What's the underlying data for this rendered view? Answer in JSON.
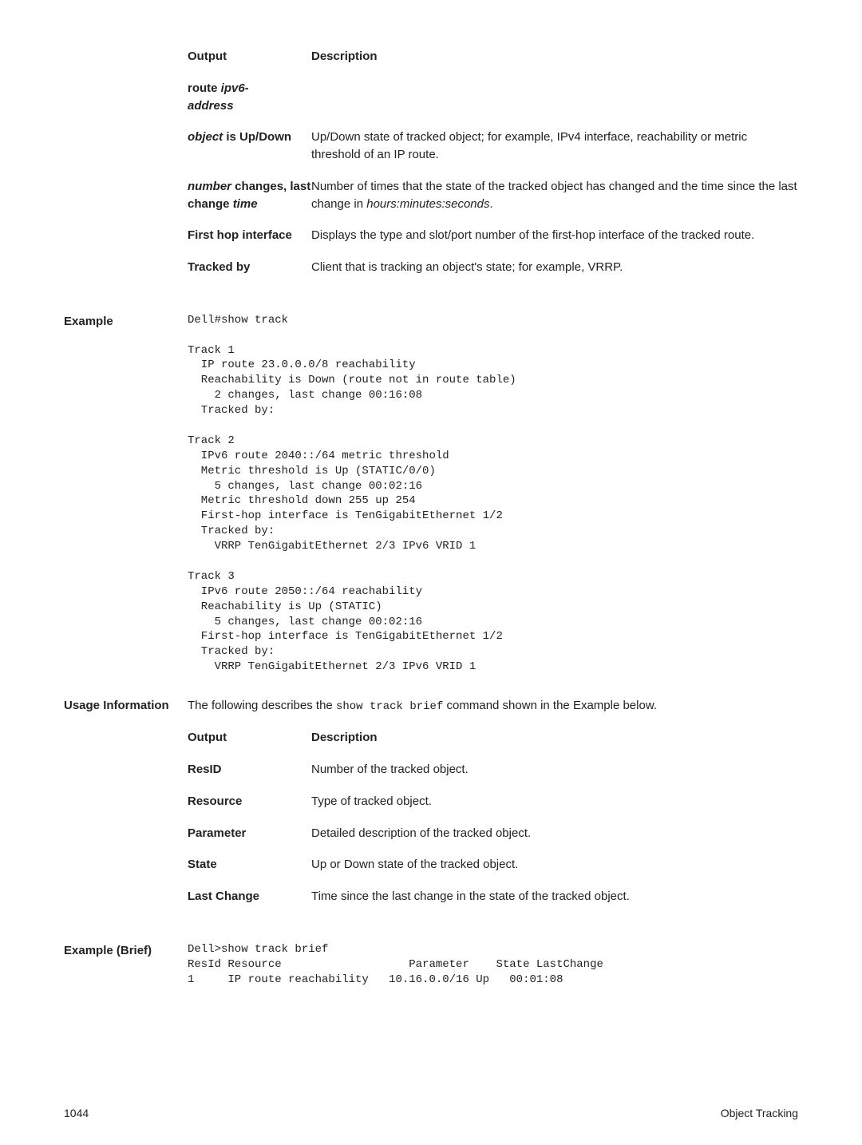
{
  "top_table": {
    "header_output": "Output",
    "header_desc": "Description",
    "rows": [
      {
        "term_line1": "route ",
        "term_em1": "ipv6-",
        "term_em2": "address",
        "desc": ""
      },
      {
        "term_em": "object",
        "term_rest": " is Up/Down",
        "desc": "Up/Down state of tracked object; for example, IPv4 interface, reachability or metric threshold of an IP route."
      },
      {
        "term_em1": "number",
        "term_mid": " changes, last change ",
        "term_em2": "time",
        "desc_part1": "Number of times that the state of the tracked object has changed and the time since the last change in ",
        "desc_em": "hours:minutes:seconds",
        "desc_part2": "."
      },
      {
        "term": "First hop interface",
        "desc": "Displays the type and slot/port number of the first-hop interface of the tracked route."
      },
      {
        "term": "Tracked by",
        "desc": "Client that is tracking an object's state; for example, VRRP."
      }
    ]
  },
  "example": {
    "label": "Example",
    "code": "Dell#show track\n\nTrack 1\n  IP route 23.0.0.0/8 reachability\n  Reachability is Down (route not in route table)\n    2 changes, last change 00:16:08\n  Tracked by:\n\nTrack 2\n  IPv6 route 2040::/64 metric threshold\n  Metric threshold is Up (STATIC/0/0)\n    5 changes, last change 00:02:16\n  Metric threshold down 255 up 254\n  First-hop interface is TenGigabitEthernet 1/2\n  Tracked by:\n    VRRP TenGigabitEthernet 2/3 IPv6 VRID 1\n\nTrack 3\n  IPv6 route 2050::/64 reachability\n  Reachability is Up (STATIC)\n    5 changes, last change 00:02:16\n  First-hop interface is TenGigabitEthernet 1/2\n  Tracked by:\n    VRRP TenGigabitEthernet 2/3 IPv6 VRID 1"
  },
  "usage": {
    "label": "Usage Information",
    "intro_part1": "The following describes the ",
    "intro_code": "show track brief",
    "intro_part2": " command shown in the Example below.",
    "header_output": "Output",
    "header_desc": "Description",
    "rows": [
      {
        "term": "ResID",
        "desc": "Number of the tracked object."
      },
      {
        "term": "Resource",
        "desc": "Type of tracked object."
      },
      {
        "term": "Parameter",
        "desc": "Detailed description of the tracked object."
      },
      {
        "term": "State",
        "desc": "Up or Down state of the tracked object."
      },
      {
        "term": "Last Change",
        "desc": "Time since the last change in the state of the tracked object."
      }
    ]
  },
  "example_brief": {
    "label": "Example (Brief)",
    "code": "Dell>show track brief\nResId Resource                   Parameter    State LastChange\n1     IP route reachability   10.16.0.0/16 Up   00:01:08"
  },
  "footer": {
    "page": "1044",
    "section": "Object Tracking"
  }
}
